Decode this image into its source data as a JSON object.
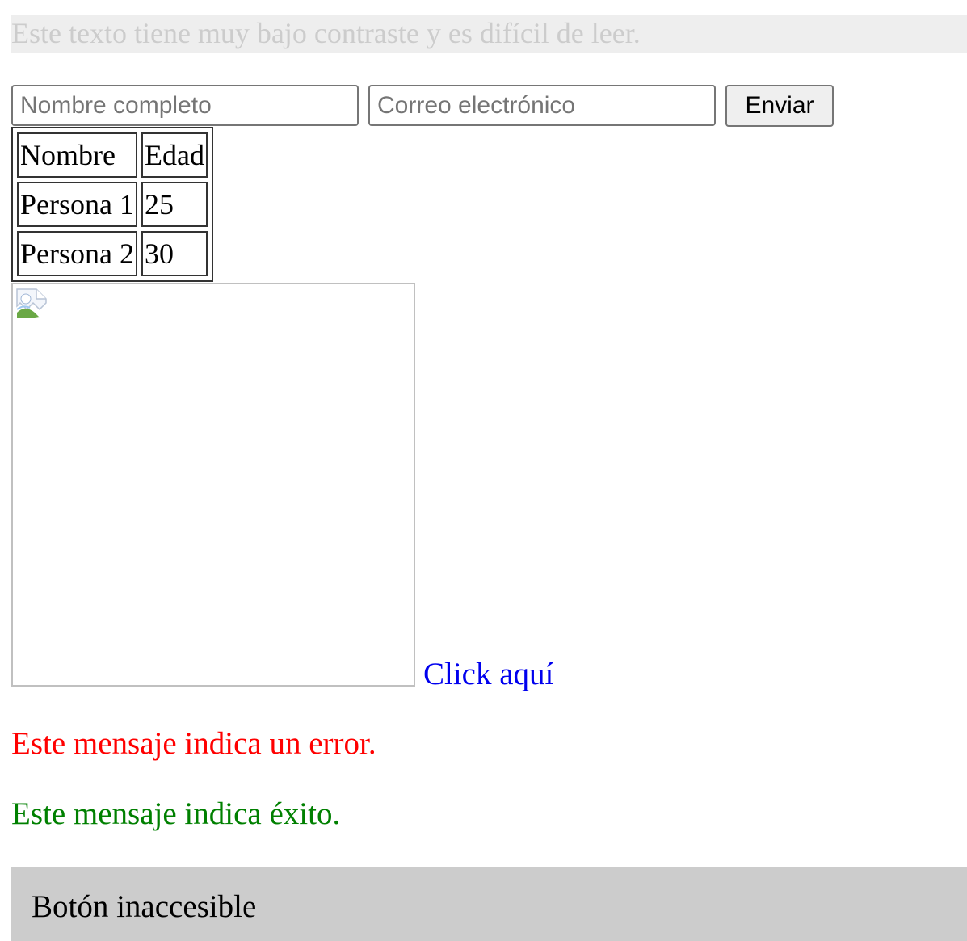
{
  "low_contrast_text": "Este texto tiene muy bajo contraste y es difícil de leer.",
  "form": {
    "name_placeholder": "Nombre completo",
    "name_value": "",
    "email_placeholder": "Correo electrónico",
    "email_value": "",
    "submit_label": "Enviar"
  },
  "table": {
    "headers": [
      "Nombre",
      "Edad"
    ],
    "rows": [
      [
        "Persona 1",
        "25"
      ],
      [
        "Persona 2",
        "30"
      ]
    ]
  },
  "image": {
    "icon": "broken-image-icon"
  },
  "link": {
    "label": "Click aquí",
    "color": "#0000ee"
  },
  "messages": {
    "error": "Este mensaje indica un error.",
    "error_color": "#ff0000",
    "success": "Este mensaje indica éxito.",
    "success_color": "#008000"
  },
  "inaccessible_button": {
    "label": "Botón inaccesible"
  },
  "colors": {
    "low_contrast_bg": "#eeeeee",
    "low_contrast_fg": "#cccccc",
    "inaccessible_bg": "#cccccc"
  }
}
